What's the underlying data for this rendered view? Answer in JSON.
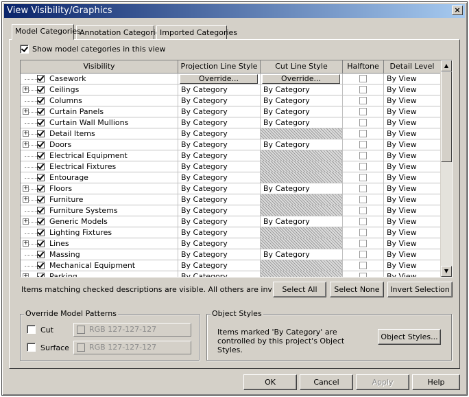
{
  "window": {
    "title": "View Visibility/Graphics",
    "close": "×"
  },
  "tabs": [
    "Model Categories",
    "Annotation Categories",
    "Imported Categories"
  ],
  "show_categories": {
    "label": "Show model categories in this view",
    "checked": true
  },
  "columns": [
    "Visibility",
    "Projection Line Style",
    "Cut Line Style",
    "Halftone",
    "Detail Level"
  ],
  "override_label": "Override...",
  "rows": [
    {
      "name": "Casework",
      "expander": false,
      "projection": "",
      "cut": "",
      "detail": "By View",
      "override": true
    },
    {
      "name": "Ceilings",
      "expander": true,
      "projection": "By Category",
      "cut": "By Category",
      "detail": "By View"
    },
    {
      "name": "Columns",
      "expander": false,
      "projection": "By Category",
      "cut": "By Category",
      "detail": "By View"
    },
    {
      "name": "Curtain Panels",
      "expander": true,
      "projection": "By Category",
      "cut": "By Category",
      "detail": "By View"
    },
    {
      "name": "Curtain Wall Mullions",
      "expander": false,
      "projection": "By Category",
      "cut": "By Category",
      "detail": "By View"
    },
    {
      "name": "Detail Items",
      "expander": true,
      "projection": "By Category",
      "cut": "",
      "detail": "By View"
    },
    {
      "name": "Doors",
      "expander": true,
      "projection": "By Category",
      "cut": "By Category",
      "detail": "By View"
    },
    {
      "name": "Electrical Equipment",
      "expander": false,
      "projection": "By Category",
      "cut": "",
      "detail": "By View"
    },
    {
      "name": "Electrical Fixtures",
      "expander": false,
      "projection": "By Category",
      "cut": "",
      "detail": "By View"
    },
    {
      "name": "Entourage",
      "expander": false,
      "projection": "By Category",
      "cut": "",
      "detail": "By View"
    },
    {
      "name": "Floors",
      "expander": true,
      "projection": "By Category",
      "cut": "By Category",
      "detail": "By View"
    },
    {
      "name": "Furniture",
      "expander": true,
      "projection": "By Category",
      "cut": "",
      "detail": "By View"
    },
    {
      "name": "Furniture Systems",
      "expander": false,
      "projection": "By Category",
      "cut": "",
      "detail": "By View"
    },
    {
      "name": "Generic Models",
      "expander": true,
      "projection": "By Category",
      "cut": "By Category",
      "detail": "By View"
    },
    {
      "name": "Lighting Fixtures",
      "expander": false,
      "projection": "By Category",
      "cut": "",
      "detail": "By View"
    },
    {
      "name": "Lines",
      "expander": true,
      "projection": "By Category",
      "cut": "",
      "detail": "By View"
    },
    {
      "name": "Massing",
      "expander": false,
      "projection": "By Category",
      "cut": "By Category",
      "detail": "By View"
    },
    {
      "name": "Mechanical Equipment",
      "expander": false,
      "projection": "By Category",
      "cut": "",
      "detail": "By View"
    },
    {
      "name": "Parking",
      "expander": true,
      "projection": "By Category",
      "cut": "",
      "detail": "By View"
    }
  ],
  "note": "Items matching checked descriptions are visible.  All others are invisible.",
  "select_all": "Select All",
  "select_none": "Select None",
  "invert_selection": "Invert Selection",
  "override_patterns": {
    "title": "Override Model Patterns",
    "cut_label": "Cut",
    "surface_label": "Surface",
    "cut_rgb": "RGB 127-127-127",
    "surface_rgb": "RGB 127-127-127"
  },
  "object_styles": {
    "title": "Object Styles",
    "text": "Items marked 'By Category' are controlled by this project's Object Styles.",
    "button": "Object Styles..."
  },
  "footer": {
    "ok": "OK",
    "cancel": "Cancel",
    "apply": "Apply",
    "help": "Help"
  },
  "colors": {
    "titlebar_start": "#0a246a",
    "titlebar_end": "#a6caf0",
    "face": "#d4d0c8"
  }
}
